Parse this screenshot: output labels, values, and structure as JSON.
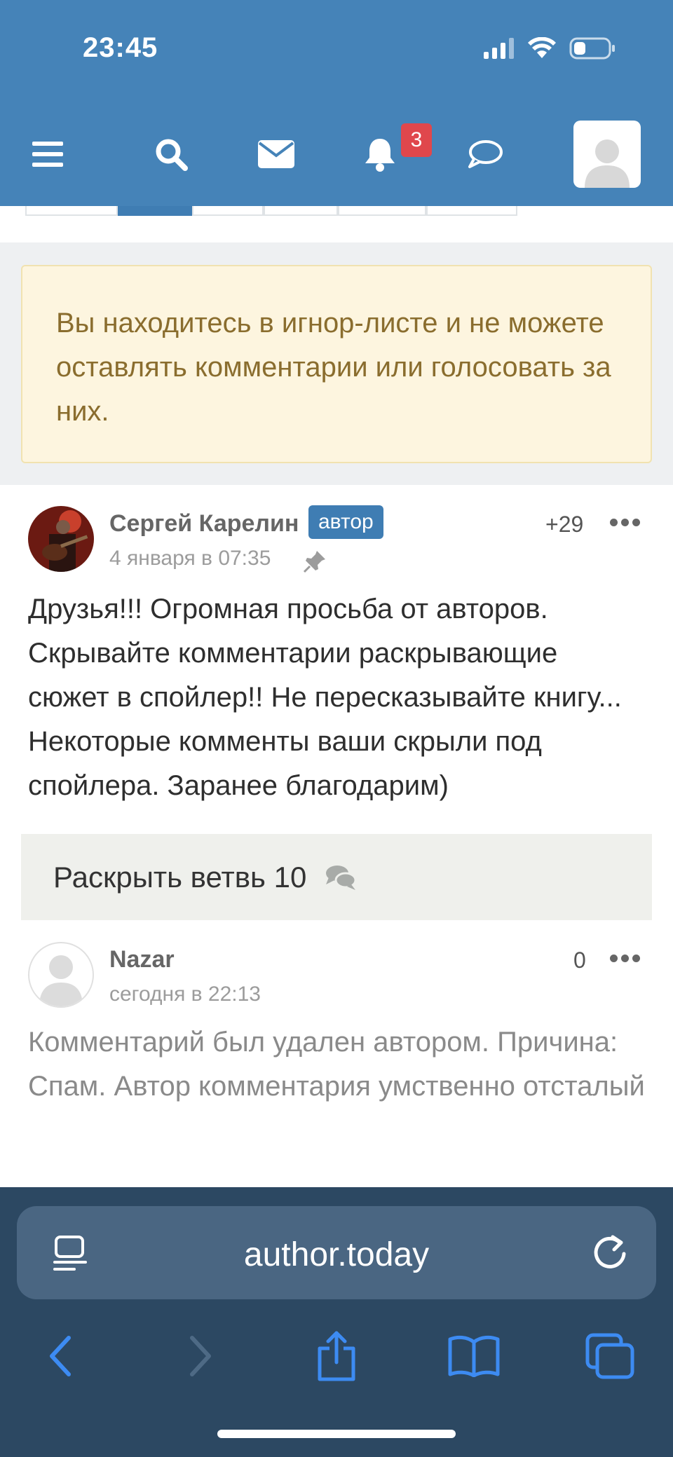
{
  "status_bar": {
    "time": "23:45"
  },
  "header": {
    "notifications_count": "3",
    "icons": [
      "menu-icon",
      "search-icon",
      "mail-icon",
      "bell-icon",
      "chat-icon"
    ]
  },
  "notice": {
    "text": "Вы находитесь в игнор-листе и не можете оставлять комментарии или голосовать за них."
  },
  "comments": [
    {
      "author": "Сергей Карелин",
      "badge": "автор",
      "date": "4 января в 07:35",
      "score": "+29",
      "text": "Друзья!!!  Огромная просьба от авторов. Скрывайте комментарии раскрывающие сюжет в спойлер!! Не пересказывайте книгу... Некоторые комменты ваши скрыли под спойлера. Заранее благодарим)"
    },
    {
      "author": "Nazar",
      "date": "сегодня в 22:13",
      "score": "0",
      "text": "Комментарий был удален автором. Причина: Спам. Автор комментария умственно отсталый"
    }
  ],
  "thread": {
    "expand_label": "Раскрыть ветвь 10"
  },
  "browser": {
    "url": "author.today"
  },
  "colors": {
    "header": "#4583b8",
    "accent": "#3f7db3",
    "notice_bg": "#fdf5df",
    "notice_text": "#8a6d2e",
    "badge": "#e0474c",
    "safari_bar": "#2c4862"
  }
}
